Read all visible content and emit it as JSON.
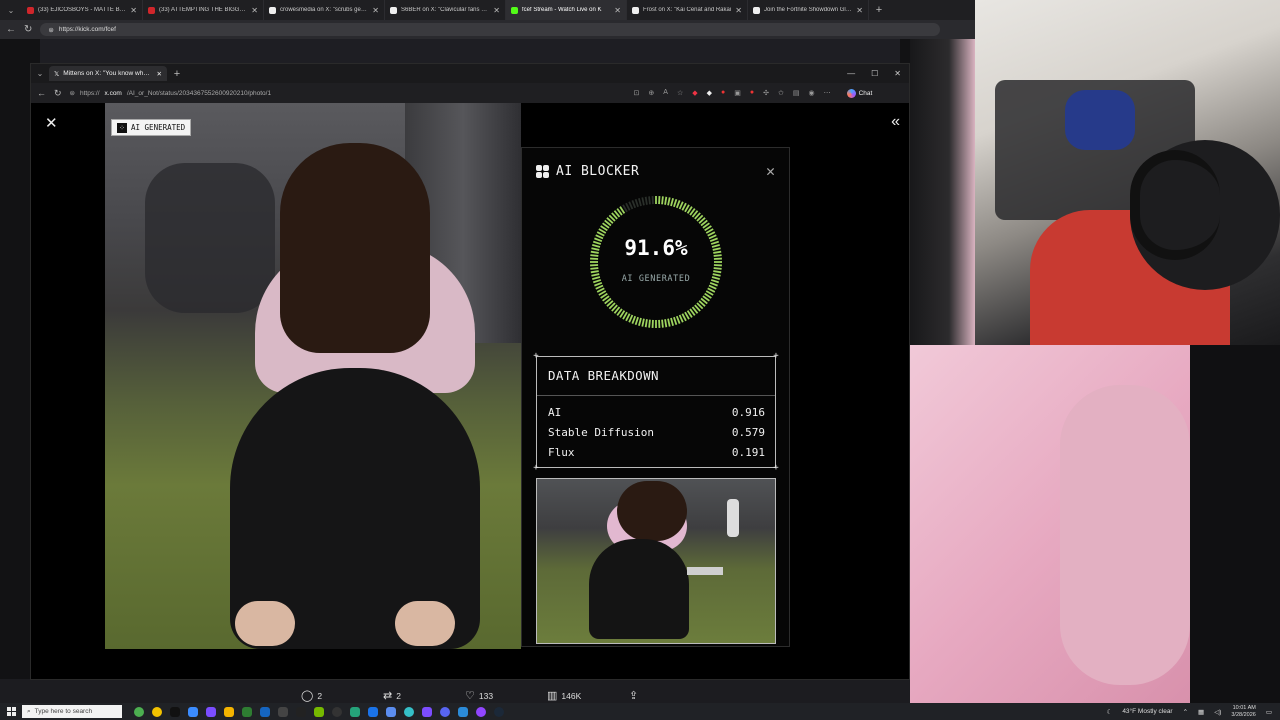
{
  "outer_browser": {
    "tabs": [
      {
        "label": "(33) EJICOSBOYS - MATTE BLAC",
        "color": "#d0262b"
      },
      {
        "label": "(33) ATTEMPTING THE BIGGEST",
        "color": "#d0262b"
      },
      {
        "label": "crowesmedia on X: \"scrubs gets s",
        "color": "#eeeeee"
      },
      {
        "label": "S6BER on X: \"Clavicular fans are S",
        "color": "#eeeeee"
      },
      {
        "label": "fcef Stream - Watch Live on K",
        "color": "#53fc18"
      },
      {
        "label": "Frost on X: \"Kai Cenat and Rakai",
        "color": "#eeeeee"
      },
      {
        "label": "Join the Fortnite Showdown Glob",
        "color": "#eeeeee"
      }
    ],
    "url": "https://kick.com/fcef"
  },
  "inner_browser": {
    "tab_label": "Mittens on X: \"You know what I t",
    "url_prefix": "https://",
    "url_domain": "x.com",
    "url_path": "/AI_or_Not/status/2034367552600920210/photo/1",
    "chat_label": "Chat"
  },
  "image_badge": "AI GENERATED",
  "ai_blocker": {
    "title": "AI BLOCKER",
    "percent_text": "91.6%",
    "percent_value": 0.916,
    "percent_label": "AI GENERATED",
    "breakdown_title": "DATA BREAKDOWN",
    "rows": [
      {
        "label": "AI",
        "value": "0.916"
      },
      {
        "label": "Stable Diffusion",
        "value": "0.579"
      },
      {
        "label": "Flux",
        "value": "0.191"
      }
    ],
    "gauge_color": "#9ed45f"
  },
  "actions": {
    "replies": "2",
    "reposts": "2",
    "likes": "133",
    "views": "146K"
  },
  "taskbar": {
    "search_placeholder": "Type here to search",
    "weather": "43°F  Mostly clear",
    "time": "10:01 AM",
    "date": "3/28/2026"
  }
}
